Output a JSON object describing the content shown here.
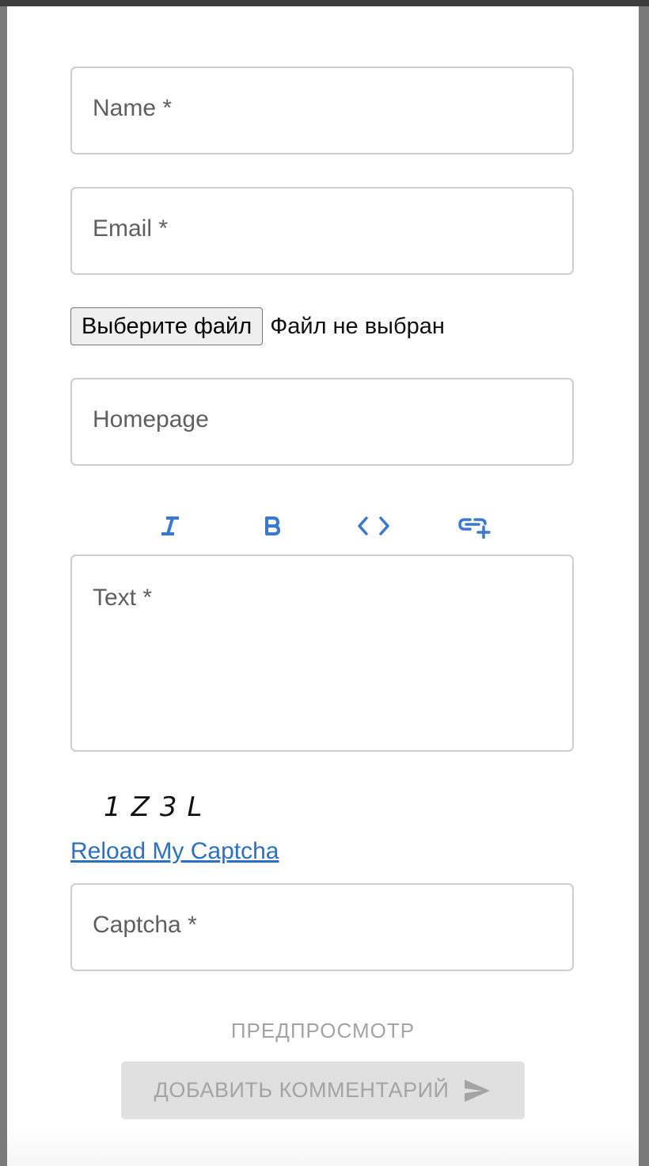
{
  "form": {
    "name_label": "Name *",
    "email_label": "Email *",
    "file": {
      "button_label": "Выберите файл",
      "status": "Файл не выбран"
    },
    "homepage_label": "Homepage",
    "text_label": "Text *",
    "captcha": {
      "image_text": "1Z3L",
      "reload_label": "Reload My Captcha",
      "input_label": "Captcha *"
    },
    "preview_label": "ПРЕДПРОСМОТР",
    "submit_label": "ДОБАВИТЬ КОММЕНТАРИЙ"
  },
  "toolbar": {
    "buttons": [
      {
        "name": "italic",
        "icon": "italic-icon"
      },
      {
        "name": "bold",
        "icon": "bold-icon"
      },
      {
        "name": "code",
        "icon": "code-icon"
      },
      {
        "name": "link",
        "icon": "add-link-icon"
      }
    ]
  },
  "colors": {
    "accent": "#3b78d0",
    "link": "#2a6fc9",
    "field_border": "#cfcfcf",
    "label": "#5f5f5f",
    "disabled_text": "#a4a4a4",
    "disabled_bg": "#e0e0e0",
    "backdrop": "#7a7a7a"
  }
}
